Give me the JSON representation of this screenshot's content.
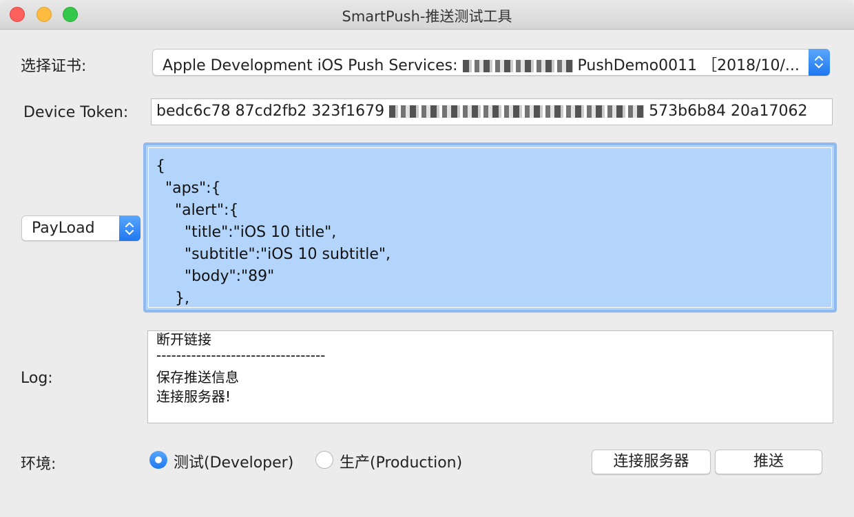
{
  "window": {
    "title": "SmartPush-推送测试工具"
  },
  "certificate": {
    "label": "选择证书:",
    "value_prefix": "Apple Development iOS Push Services:",
    "value_suffix": "PushDemo0011 ［2018/10/..."
  },
  "device_token": {
    "label": "Device Token:",
    "value_prefix": "bedc6c78 87cd2fb2 323f1679",
    "value_suffix": "573b6b84 20a17062"
  },
  "payload": {
    "mode": "PayLoad",
    "lines": [
      "{",
      "  \"aps\":{",
      "    \"alert\":{",
      "      \"title\":\"iOS 10 title\",",
      "      \"subtitle\":\"iOS 10 subtitle\",",
      "      \"body\":\"89\"",
      "    },"
    ]
  },
  "log": {
    "label": "Log:",
    "lines": [
      "断开链接",
      "----------------------------------",
      "保存推送信息",
      "连接服务器!"
    ]
  },
  "environment": {
    "label": "环境:",
    "options": [
      {
        "label": "测试(Developer)",
        "selected": true
      },
      {
        "label": "生产(Production)",
        "selected": false
      }
    ]
  },
  "buttons": {
    "connect": "连接服务器",
    "push": "推送"
  },
  "colors": {
    "accent": "#1f77f0",
    "selection": "#b3d4fb"
  }
}
